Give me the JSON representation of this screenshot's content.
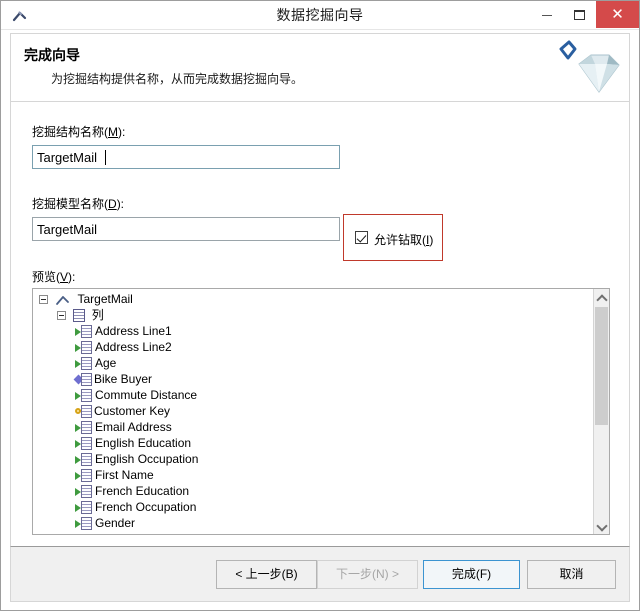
{
  "window": {
    "title": "数据挖掘向导",
    "icon": "pickaxe-icon",
    "minimize_label": "–",
    "maximize_label": "□",
    "close_label": "✕"
  },
  "header": {
    "title": "完成向导",
    "subtitle": "为挖掘结构提供名称，从而完成数据挖掘向导。",
    "art": "diamond-with-checkmark"
  },
  "form": {
    "structure_label": "挖掘结构名称(M):",
    "structure_label_plain": "挖掘结构名称",
    "structure_accel": "M",
    "structure_value": "TargetMail",
    "model_label_plain": "挖掘模型名称",
    "model_accel": "D",
    "model_value": "TargetMail",
    "drill_label_plain": "允许钻取",
    "drill_accel": "I",
    "drill_checked": true,
    "highlight_color": "#c0392b"
  },
  "preview": {
    "label_plain": "预览",
    "label_accel": "V",
    "tree": {
      "root": {
        "label": "TargetMail",
        "icon": "pickaxe-icon",
        "expanded": true
      },
      "group": {
        "label": "列",
        "icon": "table-icon",
        "expanded": true
      },
      "columns": [
        {
          "label": "Address Line1",
          "icon": "column-icon"
        },
        {
          "label": "Address Line2",
          "icon": "column-icon"
        },
        {
          "label": "Age",
          "icon": "column-icon"
        },
        {
          "label": "Bike Buyer",
          "icon": "predict-column-icon"
        },
        {
          "label": "Commute Distance",
          "icon": "column-icon"
        },
        {
          "label": "Customer Key",
          "icon": "key-column-icon"
        },
        {
          "label": "Email Address",
          "icon": "column-icon"
        },
        {
          "label": "English Education",
          "icon": "column-icon"
        },
        {
          "label": "English Occupation",
          "icon": "column-icon"
        },
        {
          "label": "First Name",
          "icon": "column-icon"
        },
        {
          "label": "French Education",
          "icon": "column-icon"
        },
        {
          "label": "French Occupation",
          "icon": "column-icon"
        },
        {
          "label": "Gender",
          "icon": "column-icon"
        }
      ]
    },
    "scrollbar": {
      "up_arrow": "▲",
      "down_arrow": "▼"
    }
  },
  "footer": {
    "back_label": "< 上一步(B)",
    "next_label": "下一步(N) >",
    "finish_label": "完成(F)",
    "cancel_label": "取消",
    "next_disabled": true,
    "finish_focused": true
  }
}
